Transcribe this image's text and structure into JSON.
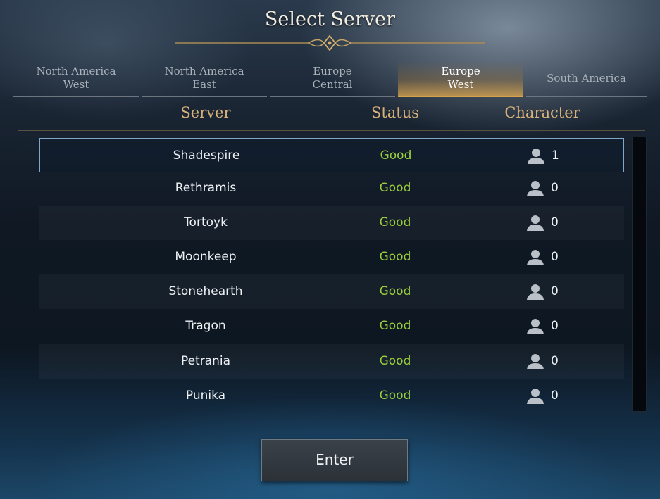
{
  "title": "Select Server",
  "tabs": [
    {
      "label": "North America\nWest",
      "active": false
    },
    {
      "label": "North America\nEast",
      "active": false
    },
    {
      "label": "Europe\nCentral",
      "active": false
    },
    {
      "label": "Europe\nWest",
      "active": true
    },
    {
      "label": "South America",
      "active": false
    }
  ],
  "columns": {
    "server": "Server",
    "status": "Status",
    "character": "Character"
  },
  "servers": [
    {
      "name": "Shadespire",
      "status": "Good",
      "characters": "1",
      "selected": true
    },
    {
      "name": "Rethramis",
      "status": "Good",
      "characters": "0"
    },
    {
      "name": "Tortoyk",
      "status": "Good",
      "characters": "0"
    },
    {
      "name": "Moonkeep",
      "status": "Good",
      "characters": "0"
    },
    {
      "name": "Stonehearth",
      "status": "Good",
      "characters": "0"
    },
    {
      "name": "Tragon",
      "status": "Good",
      "characters": "0"
    },
    {
      "name": "Petrania",
      "status": "Good",
      "characters": "0"
    },
    {
      "name": "Punika",
      "status": "Good",
      "characters": "0"
    }
  ],
  "enter_label": "Enter",
  "icons": {
    "character": "person-icon",
    "ornament": "title-ornament"
  },
  "colors": {
    "accent": "#d8a24c",
    "status_good": "#9bcf3b",
    "header_text": "#d8b27a"
  }
}
